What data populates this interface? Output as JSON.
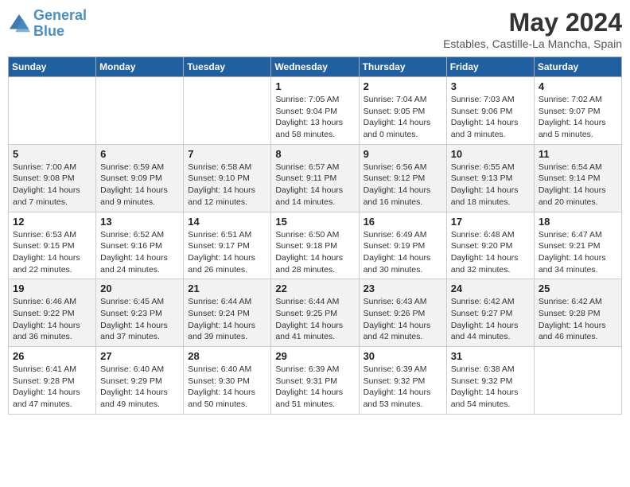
{
  "header": {
    "logo_line1": "General",
    "logo_line2": "Blue",
    "month_year": "May 2024",
    "location": "Estables, Castille-La Mancha, Spain"
  },
  "days_of_week": [
    "Sunday",
    "Monday",
    "Tuesday",
    "Wednesday",
    "Thursday",
    "Friday",
    "Saturday"
  ],
  "weeks": [
    [
      {
        "day": "",
        "info": ""
      },
      {
        "day": "",
        "info": ""
      },
      {
        "day": "",
        "info": ""
      },
      {
        "day": "1",
        "info": "Sunrise: 7:05 AM\nSunset: 9:04 PM\nDaylight: 13 hours\nand 58 minutes."
      },
      {
        "day": "2",
        "info": "Sunrise: 7:04 AM\nSunset: 9:05 PM\nDaylight: 14 hours\nand 0 minutes."
      },
      {
        "day": "3",
        "info": "Sunrise: 7:03 AM\nSunset: 9:06 PM\nDaylight: 14 hours\nand 3 minutes."
      },
      {
        "day": "4",
        "info": "Sunrise: 7:02 AM\nSunset: 9:07 PM\nDaylight: 14 hours\nand 5 minutes."
      }
    ],
    [
      {
        "day": "5",
        "info": "Sunrise: 7:00 AM\nSunset: 9:08 PM\nDaylight: 14 hours\nand 7 minutes."
      },
      {
        "day": "6",
        "info": "Sunrise: 6:59 AM\nSunset: 9:09 PM\nDaylight: 14 hours\nand 9 minutes."
      },
      {
        "day": "7",
        "info": "Sunrise: 6:58 AM\nSunset: 9:10 PM\nDaylight: 14 hours\nand 12 minutes."
      },
      {
        "day": "8",
        "info": "Sunrise: 6:57 AM\nSunset: 9:11 PM\nDaylight: 14 hours\nand 14 minutes."
      },
      {
        "day": "9",
        "info": "Sunrise: 6:56 AM\nSunset: 9:12 PM\nDaylight: 14 hours\nand 16 minutes."
      },
      {
        "day": "10",
        "info": "Sunrise: 6:55 AM\nSunset: 9:13 PM\nDaylight: 14 hours\nand 18 minutes."
      },
      {
        "day": "11",
        "info": "Sunrise: 6:54 AM\nSunset: 9:14 PM\nDaylight: 14 hours\nand 20 minutes."
      }
    ],
    [
      {
        "day": "12",
        "info": "Sunrise: 6:53 AM\nSunset: 9:15 PM\nDaylight: 14 hours\nand 22 minutes."
      },
      {
        "day": "13",
        "info": "Sunrise: 6:52 AM\nSunset: 9:16 PM\nDaylight: 14 hours\nand 24 minutes."
      },
      {
        "day": "14",
        "info": "Sunrise: 6:51 AM\nSunset: 9:17 PM\nDaylight: 14 hours\nand 26 minutes."
      },
      {
        "day": "15",
        "info": "Sunrise: 6:50 AM\nSunset: 9:18 PM\nDaylight: 14 hours\nand 28 minutes."
      },
      {
        "day": "16",
        "info": "Sunrise: 6:49 AM\nSunset: 9:19 PM\nDaylight: 14 hours\nand 30 minutes."
      },
      {
        "day": "17",
        "info": "Sunrise: 6:48 AM\nSunset: 9:20 PM\nDaylight: 14 hours\nand 32 minutes."
      },
      {
        "day": "18",
        "info": "Sunrise: 6:47 AM\nSunset: 9:21 PM\nDaylight: 14 hours\nand 34 minutes."
      }
    ],
    [
      {
        "day": "19",
        "info": "Sunrise: 6:46 AM\nSunset: 9:22 PM\nDaylight: 14 hours\nand 36 minutes."
      },
      {
        "day": "20",
        "info": "Sunrise: 6:45 AM\nSunset: 9:23 PM\nDaylight: 14 hours\nand 37 minutes."
      },
      {
        "day": "21",
        "info": "Sunrise: 6:44 AM\nSunset: 9:24 PM\nDaylight: 14 hours\nand 39 minutes."
      },
      {
        "day": "22",
        "info": "Sunrise: 6:44 AM\nSunset: 9:25 PM\nDaylight: 14 hours\nand 41 minutes."
      },
      {
        "day": "23",
        "info": "Sunrise: 6:43 AM\nSunset: 9:26 PM\nDaylight: 14 hours\nand 42 minutes."
      },
      {
        "day": "24",
        "info": "Sunrise: 6:42 AM\nSunset: 9:27 PM\nDaylight: 14 hours\nand 44 minutes."
      },
      {
        "day": "25",
        "info": "Sunrise: 6:42 AM\nSunset: 9:28 PM\nDaylight: 14 hours\nand 46 minutes."
      }
    ],
    [
      {
        "day": "26",
        "info": "Sunrise: 6:41 AM\nSunset: 9:28 PM\nDaylight: 14 hours\nand 47 minutes."
      },
      {
        "day": "27",
        "info": "Sunrise: 6:40 AM\nSunset: 9:29 PM\nDaylight: 14 hours\nand 49 minutes."
      },
      {
        "day": "28",
        "info": "Sunrise: 6:40 AM\nSunset: 9:30 PM\nDaylight: 14 hours\nand 50 minutes."
      },
      {
        "day": "29",
        "info": "Sunrise: 6:39 AM\nSunset: 9:31 PM\nDaylight: 14 hours\nand 51 minutes."
      },
      {
        "day": "30",
        "info": "Sunrise: 6:39 AM\nSunset: 9:32 PM\nDaylight: 14 hours\nand 53 minutes."
      },
      {
        "day": "31",
        "info": "Sunrise: 6:38 AM\nSunset: 9:32 PM\nDaylight: 14 hours\nand 54 minutes."
      },
      {
        "day": "",
        "info": ""
      }
    ]
  ]
}
